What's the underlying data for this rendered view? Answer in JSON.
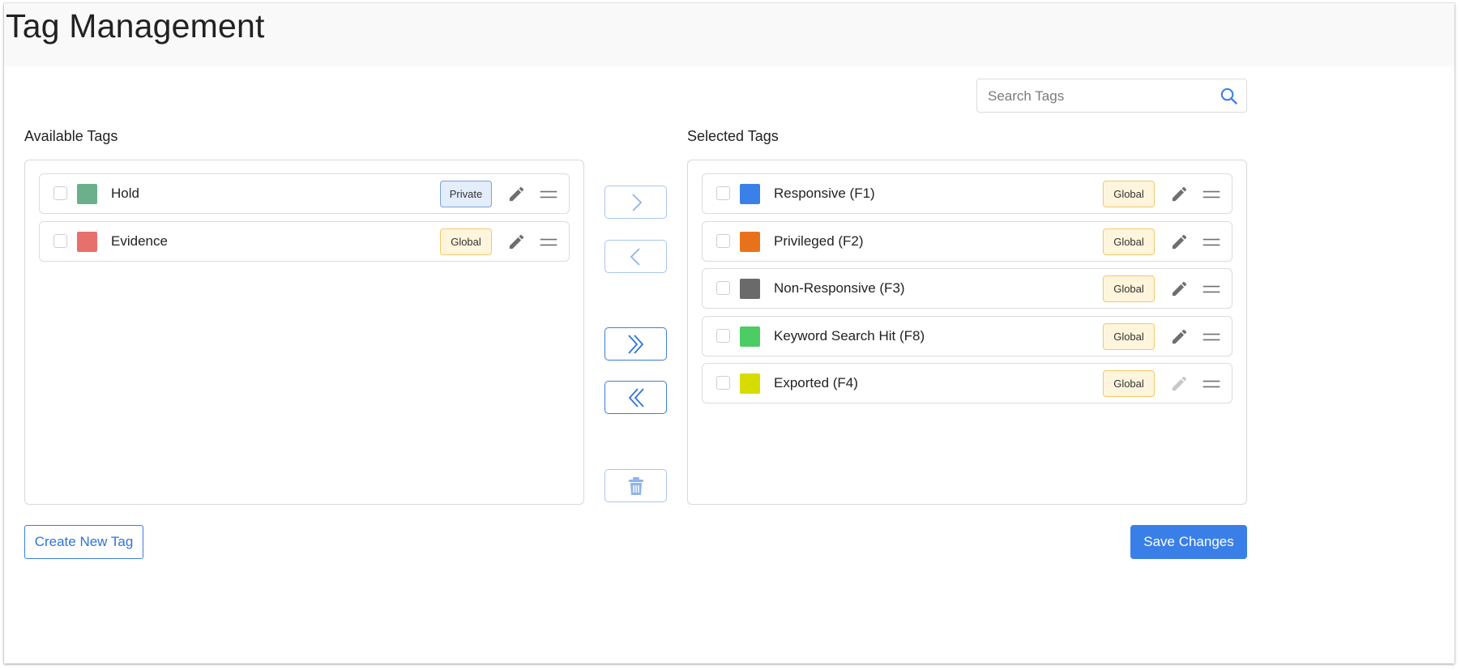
{
  "header": {
    "title": "Tag Management"
  },
  "search": {
    "placeholder": "Search Tags",
    "value": ""
  },
  "available": {
    "heading": "Available Tags",
    "tags": [
      {
        "name": "Hold",
        "color": "#6bb08a",
        "badge": "Private",
        "badge_type": "private",
        "checked": false
      },
      {
        "name": "Evidence",
        "color": "#e8706c",
        "badge": "Global",
        "badge_type": "global",
        "checked": false
      }
    ]
  },
  "selected": {
    "heading": "Selected Tags",
    "tags": [
      {
        "name": "Responsive (F1)",
        "color": "#3b80e8",
        "badge": "Global",
        "badge_type": "global",
        "checked": false,
        "editable": true
      },
      {
        "name": "Privileged (F2)",
        "color": "#e8721a",
        "badge": "Global",
        "badge_type": "global",
        "checked": false,
        "editable": true
      },
      {
        "name": "Non-Responsive (F3)",
        "color": "#6a6a6a",
        "badge": "Global",
        "badge_type": "global",
        "checked": false,
        "editable": true
      },
      {
        "name": "Keyword Search Hit (F8)",
        "color": "#4ccc64",
        "badge": "Global",
        "badge_type": "global",
        "checked": false,
        "editable": true
      },
      {
        "name": "Exported (F4)",
        "color": "#d6dc00",
        "badge": "Global",
        "badge_type": "global",
        "checked": false,
        "editable": false
      }
    ]
  },
  "transfer": {
    "move_right_icon": "chevron-right-icon",
    "move_left_icon": "chevron-left-icon",
    "move_all_right_icon": "double-chevron-right-icon",
    "move_all_left_icon": "double-chevron-left-icon",
    "delete_icon": "trash-icon"
  },
  "footer": {
    "create_label": "Create New Tag",
    "save_label": "Save Changes"
  },
  "colors": {
    "accent": "#3a7fe8",
    "badge_global_bg": "#fff5dc",
    "badge_private_bg": "#e3edfb"
  }
}
